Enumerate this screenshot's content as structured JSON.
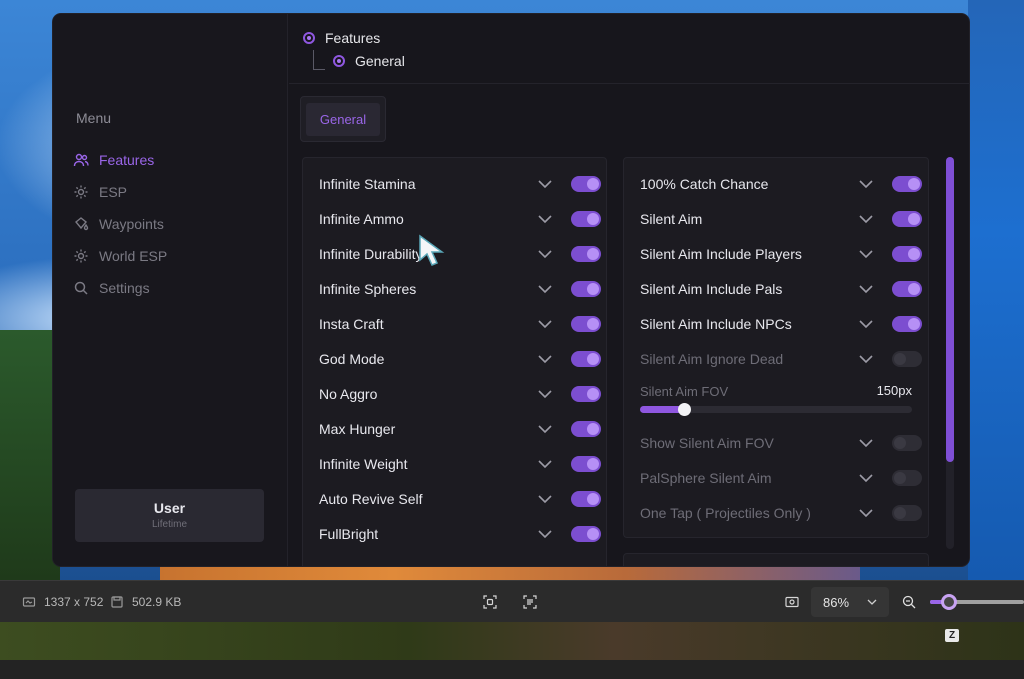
{
  "sidebar": {
    "menu_title": "Menu",
    "items": [
      {
        "label": "Features",
        "icon": "users-icon",
        "active": true
      },
      {
        "label": "ESP",
        "icon": "gear-icon",
        "active": false
      },
      {
        "label": "Waypoints",
        "icon": "bucket-icon",
        "active": false
      },
      {
        "label": "World ESP",
        "icon": "gear-icon",
        "active": false
      },
      {
        "label": "Settings",
        "icon": "search-icon",
        "active": false
      }
    ],
    "user": {
      "name": "User",
      "plan": "Lifetime"
    }
  },
  "breadcrumb": {
    "root": "Features",
    "child": "General"
  },
  "tabs": [
    {
      "label": "General",
      "active": true
    }
  ],
  "left_panel": {
    "rows": [
      {
        "label": "Infinite Stamina",
        "enabled": true
      },
      {
        "label": "Infinite Ammo",
        "enabled": true
      },
      {
        "label": "Infinite Durability",
        "enabled": true
      },
      {
        "label": "Infinite Spheres",
        "enabled": true
      },
      {
        "label": "Insta Craft",
        "enabled": true
      },
      {
        "label": "God Mode",
        "enabled": true
      },
      {
        "label": "No Aggro",
        "enabled": true
      },
      {
        "label": "Max Hunger",
        "enabled": true
      },
      {
        "label": "Infinite Weight",
        "enabled": true
      },
      {
        "label": "Auto Revive Self",
        "enabled": true
      },
      {
        "label": "FullBright",
        "enabled": true
      }
    ]
  },
  "right_panel": {
    "rows": [
      {
        "label": "100% Catch Chance",
        "enabled": true
      },
      {
        "label": "Silent Aim",
        "enabled": true
      },
      {
        "label": "Silent Aim Include Players",
        "enabled": true
      },
      {
        "label": "Silent Aim Include Pals",
        "enabled": true
      },
      {
        "label": "Silent Aim Include NPCs",
        "enabled": true
      },
      {
        "label": "Silent Aim Ignore Dead",
        "enabled": false
      }
    ],
    "fov_slider": {
      "label": "Silent Aim FOV",
      "value_text": "150px",
      "fraction": 0.16
    },
    "rows_after": [
      {
        "label": "Show Silent Aim FOV",
        "enabled": false
      },
      {
        "label": "PalSphere Silent Aim",
        "enabled": false
      },
      {
        "label": "One Tap ( Projectiles Only )",
        "enabled": false
      }
    ]
  },
  "statusbar": {
    "dimensions": "1337 x 752",
    "filesize": "502.9 KB",
    "zoom": "86%",
    "badge": "Z"
  },
  "colors": {
    "accent": "#8f57e0",
    "window_bg": "#17161c"
  }
}
